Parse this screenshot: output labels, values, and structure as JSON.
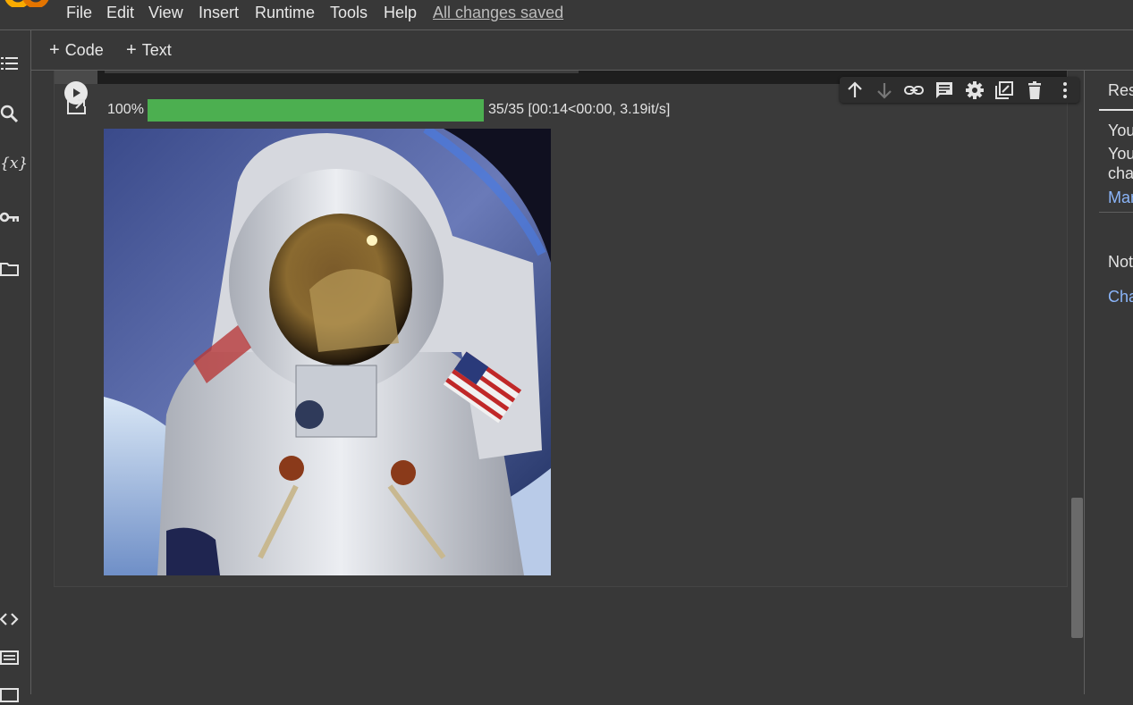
{
  "menu": {
    "items": [
      "File",
      "Edit",
      "View",
      "Insert",
      "Runtime",
      "Tools",
      "Help"
    ],
    "status": "All changes saved"
  },
  "toolbar": {
    "add_code": "Code",
    "add_text": "Text",
    "plus_glyph": "+"
  },
  "left_rail": {
    "icons": [
      "table-of-contents-icon",
      "search-icon",
      "variables-icon",
      "secrets-key-icon",
      "files-folder-icon",
      "code-snippets-icon",
      "command-palette-icon"
    ],
    "variables_glyph": "{x}"
  },
  "cell_toolbar": {
    "icons": [
      "move-up-icon",
      "move-down-icon",
      "link-icon",
      "comment-icon",
      "settings-icon",
      "mirror-cell-icon",
      "delete-icon",
      "more-icon"
    ]
  },
  "output": {
    "percent": "100%",
    "progress_fraction": 1.0,
    "progress_text": "35/35 [00:14<00:00, 3.19it/s]",
    "image_subject": "astronaut-image"
  },
  "right_panel": {
    "tab_label": "Res",
    "line1": "You",
    "line2": "You",
    "line3": "cha",
    "link1": "Mar",
    "line4": "Not",
    "link2": "Cha"
  },
  "colors": {
    "background": "#383838",
    "progress": "#4caf50",
    "link": "#8ab4f8"
  }
}
